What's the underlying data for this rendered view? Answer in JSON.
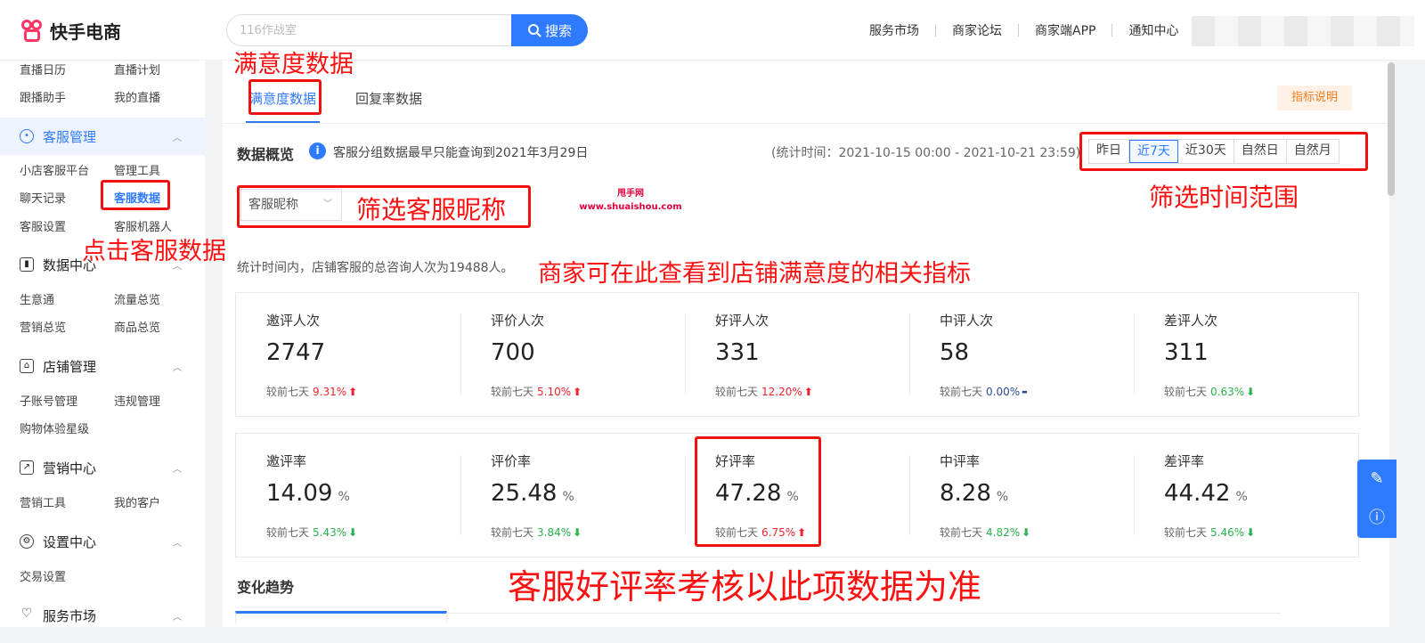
{
  "app": {
    "logo_text": "快手电商"
  },
  "search": {
    "placeholder": "116作战室",
    "button_label": "搜索"
  },
  "topnav": [
    "服务市场",
    "商家论坛",
    "商家端APP",
    "通知中心"
  ],
  "sidebar": {
    "rows": [
      [
        "直播日历",
        "直播计划"
      ],
      [
        "跟播助手",
        "我的直播"
      ]
    ],
    "groups": [
      {
        "label": "客服管理",
        "icon": "chat-icon",
        "rows": [
          [
            "小店客服平台",
            "管理工具"
          ],
          [
            "聊天记录",
            "客服数据"
          ],
          [
            "客服设置",
            "客服机器人"
          ]
        ]
      },
      {
        "label": "数据中心",
        "icon": "chart-icon",
        "rows": [
          [
            "生意通",
            "流量总览"
          ],
          [
            "营销总览",
            "商品总览"
          ]
        ]
      },
      {
        "label": "店铺管理",
        "icon": "store-icon",
        "rows": [
          [
            "子账号管理",
            "违规管理"
          ],
          [
            "购物体验星级"
          ]
        ]
      },
      {
        "label": "营销中心",
        "icon": "trend-icon",
        "rows": [
          [
            "营销工具",
            "我的客户"
          ]
        ]
      },
      {
        "label": "设置中心",
        "icon": "gear-icon",
        "rows": [
          [
            "交易设置"
          ]
        ]
      },
      {
        "label": "服务市场",
        "icon": "heart-icon",
        "rows": []
      }
    ]
  },
  "tabs": [
    "满意度数据",
    "回复率数据"
  ],
  "metric_button": "指标说明",
  "overview": {
    "title": "数据概览",
    "note": "客服分组数据最早只能查询到2021年3月29日",
    "stat_time": "(统计时间：2021-10-15 00:00 - 2021-10-21 23:59)",
    "ranges": [
      "昨日",
      "近7天",
      "近30天",
      "自然日",
      "自然月"
    ],
    "active_range": "近7天",
    "select_label": "客服昵称",
    "summary": "统计时间内，店铺客服的总咨询人次为19488人。"
  },
  "cards_row1": [
    {
      "label": "邀评人次",
      "value": "2747",
      "unit": "",
      "cmp_label": "较前七天",
      "pct": "9.31%",
      "trend": "up"
    },
    {
      "label": "评价人次",
      "value": "700",
      "unit": "",
      "cmp_label": "较前七天",
      "pct": "5.10%",
      "trend": "up"
    },
    {
      "label": "好评人次",
      "value": "331",
      "unit": "",
      "cmp_label": "较前七天",
      "pct": "12.20%",
      "trend": "up"
    },
    {
      "label": "中评人次",
      "value": "58",
      "unit": "",
      "cmp_label": "较前七天",
      "pct": "0.00%",
      "trend": "flat"
    },
    {
      "label": "差评人次",
      "value": "311",
      "unit": "",
      "cmp_label": "较前七天",
      "pct": "0.63%",
      "trend": "down"
    }
  ],
  "cards_row2": [
    {
      "label": "邀评率",
      "value": "14.09",
      "unit": "%",
      "cmp_label": "较前七天",
      "pct": "5.43%",
      "trend": "down"
    },
    {
      "label": "评价率",
      "value": "25.48",
      "unit": "%",
      "cmp_label": "较前七天",
      "pct": "3.84%",
      "trend": "down"
    },
    {
      "label": "好评率",
      "value": "47.28",
      "unit": "%",
      "cmp_label": "较前七天",
      "pct": "6.75%",
      "trend": "up"
    },
    {
      "label": "中评率",
      "value": "8.28",
      "unit": "%",
      "cmp_label": "较前七天",
      "pct": "4.82%",
      "trend": "down"
    },
    {
      "label": "差评率",
      "value": "44.42",
      "unit": "%",
      "cmp_label": "较前七天",
      "pct": "5.46%",
      "trend": "down"
    }
  ],
  "trend_title": "变化趋势",
  "annotations": {
    "a1": "满意度数据",
    "a2": "点击客服数据",
    "a3": "筛选客服昵称",
    "a4": "筛选时间范围",
    "a5": "商家可在此查看到店铺满意度的相关指标",
    "a6": "客服好评率考核以此项数据为准"
  },
  "watermark": {
    "line1": "甩手网",
    "line2": "www.shuaishou.com"
  },
  "colors": {
    "accent": "#2f7bff",
    "annotation": "#f01010",
    "up": "#f5222d",
    "down": "#2bb24c"
  }
}
